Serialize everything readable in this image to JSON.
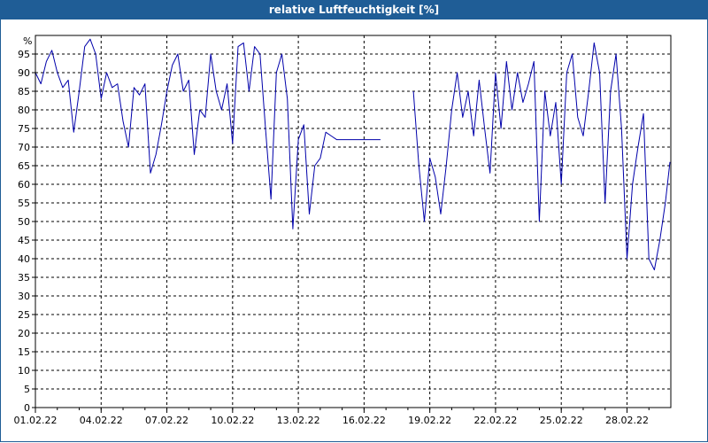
{
  "window": {
    "title": "relative Luftfeuchtigkeit [%]"
  },
  "chart_data": {
    "type": "line",
    "title": "relative Luftfeuchtigkeit [%]",
    "ylabel": "%",
    "ylim": [
      0,
      100
    ],
    "yticks": [
      0,
      5,
      10,
      15,
      20,
      25,
      30,
      35,
      40,
      45,
      50,
      55,
      60,
      65,
      70,
      75,
      80,
      85,
      90,
      95
    ],
    "xlim": [
      "2022-02-01",
      "2022-03-02"
    ],
    "x_tick_labels": [
      "01.02.22",
      "04.02.22",
      "07.02.22",
      "10.02.22",
      "13.02.22",
      "16.02.22",
      "19.02.22",
      "22.02.22",
      "25.02.22",
      "28.02.22"
    ],
    "grid": true,
    "colors": {
      "line": "#0000aa",
      "title_bar": "#1f5d96",
      "grid": "#000000"
    },
    "series": [
      {
        "segments": [
          {
            "x": [
              "2022-02-01 00:00",
              "2022-02-01 06:00",
              "2022-02-01 12:00",
              "2022-02-01 18:00",
              "2022-02-02 00:00",
              "2022-02-02 06:00",
              "2022-02-02 12:00",
              "2022-02-02 18:00",
              "2022-02-03 00:00",
              "2022-02-03 06:00",
              "2022-02-03 12:00",
              "2022-02-03 18:00",
              "2022-02-04 00:00",
              "2022-02-04 06:00",
              "2022-02-04 12:00",
              "2022-02-04 18:00",
              "2022-02-05 00:00",
              "2022-02-05 06:00",
              "2022-02-05 12:00",
              "2022-02-05 18:00",
              "2022-02-06 00:00",
              "2022-02-06 06:00",
              "2022-02-06 12:00",
              "2022-02-06 18:00",
              "2022-02-07 00:00",
              "2022-02-07 06:00",
              "2022-02-07 12:00",
              "2022-02-07 18:00",
              "2022-02-08 00:00",
              "2022-02-08 06:00",
              "2022-02-08 12:00",
              "2022-02-08 18:00",
              "2022-02-09 00:00",
              "2022-02-09 06:00",
              "2022-02-09 12:00",
              "2022-02-09 18:00",
              "2022-02-10 00:00",
              "2022-02-10 06:00",
              "2022-02-10 12:00",
              "2022-02-10 18:00",
              "2022-02-11 00:00",
              "2022-02-11 06:00",
              "2022-02-11 12:00",
              "2022-02-11 18:00",
              "2022-02-12 00:00",
              "2022-02-12 06:00",
              "2022-02-12 12:00",
              "2022-02-12 18:00",
              "2022-02-13 00:00",
              "2022-02-13 06:00",
              "2022-02-13 12:00",
              "2022-02-13 18:00",
              "2022-02-14 00:00",
              "2022-02-14 06:00",
              "2022-02-14 12:00",
              "2022-02-14 18:00",
              "2022-02-15 00:00",
              "2022-02-15 12:00",
              "2022-02-16 00:00",
              "2022-02-16 12:00",
              "2022-02-16 18:00"
            ],
            "y": [
              90,
              87,
              93,
              96,
              90,
              86,
              88,
              74,
              85,
              97,
              99,
              95,
              83,
              90,
              86,
              87,
              77,
              70,
              86,
              84,
              87,
              63,
              68,
              76,
              85,
              92,
              95,
              85,
              88,
              68,
              80,
              78,
              95,
              85,
              80,
              87,
              71,
              97,
              98,
              85,
              97,
              95,
              75,
              56,
              90,
              95,
              83,
              48,
              72,
              76,
              52,
              65,
              67,
              74,
              73,
              72,
              72,
              72,
              72,
              72,
              72
            ]
          },
          {
            "x": [
              "2022-02-18 06:00",
              "2022-02-18 12:00",
              "2022-02-18 18:00",
              "2022-02-19 00:00",
              "2022-02-19 06:00",
              "2022-02-19 12:00",
              "2022-02-19 18:00",
              "2022-02-20 00:00",
              "2022-02-20 06:00",
              "2022-02-20 12:00",
              "2022-02-20 18:00",
              "2022-02-21 00:00",
              "2022-02-21 06:00",
              "2022-02-21 12:00",
              "2022-02-21 18:00",
              "2022-02-22 00:00",
              "2022-02-22 06:00",
              "2022-02-22 12:00",
              "2022-02-22 18:00",
              "2022-02-23 00:00",
              "2022-02-23 06:00",
              "2022-02-23 12:00",
              "2022-02-23 18:00",
              "2022-02-24 00:00",
              "2022-02-24 06:00",
              "2022-02-24 12:00",
              "2022-02-24 18:00",
              "2022-02-25 00:00",
              "2022-02-25 06:00",
              "2022-02-25 12:00",
              "2022-02-25 18:00",
              "2022-02-26 00:00",
              "2022-02-26 06:00",
              "2022-02-26 12:00",
              "2022-02-26 18:00",
              "2022-02-27 00:00",
              "2022-02-27 06:00",
              "2022-02-27 12:00",
              "2022-02-27 18:00",
              "2022-02-28 00:00",
              "2022-02-28 06:00",
              "2022-02-28 12:00",
              "2022-02-28 18:00",
              "2022-03-01 00:00",
              "2022-03-01 06:00",
              "2022-03-01 12:00",
              "2022-03-01 18:00",
              "2022-03-01 23:00"
            ],
            "y": [
              85,
              65,
              50,
              67,
              62,
              52,
              65,
              80,
              90,
              78,
              85,
              73,
              88,
              75,
              63,
              90,
              75,
              93,
              80,
              90,
              82,
              87,
              93,
              50,
              85,
              73,
              82,
              60,
              90,
              95,
              78,
              73,
              85,
              98,
              90,
              55,
              85,
              95,
              75,
              40,
              60,
              70,
              79,
              40,
              37,
              45,
              55,
              66
            ]
          }
        ]
      }
    ]
  }
}
